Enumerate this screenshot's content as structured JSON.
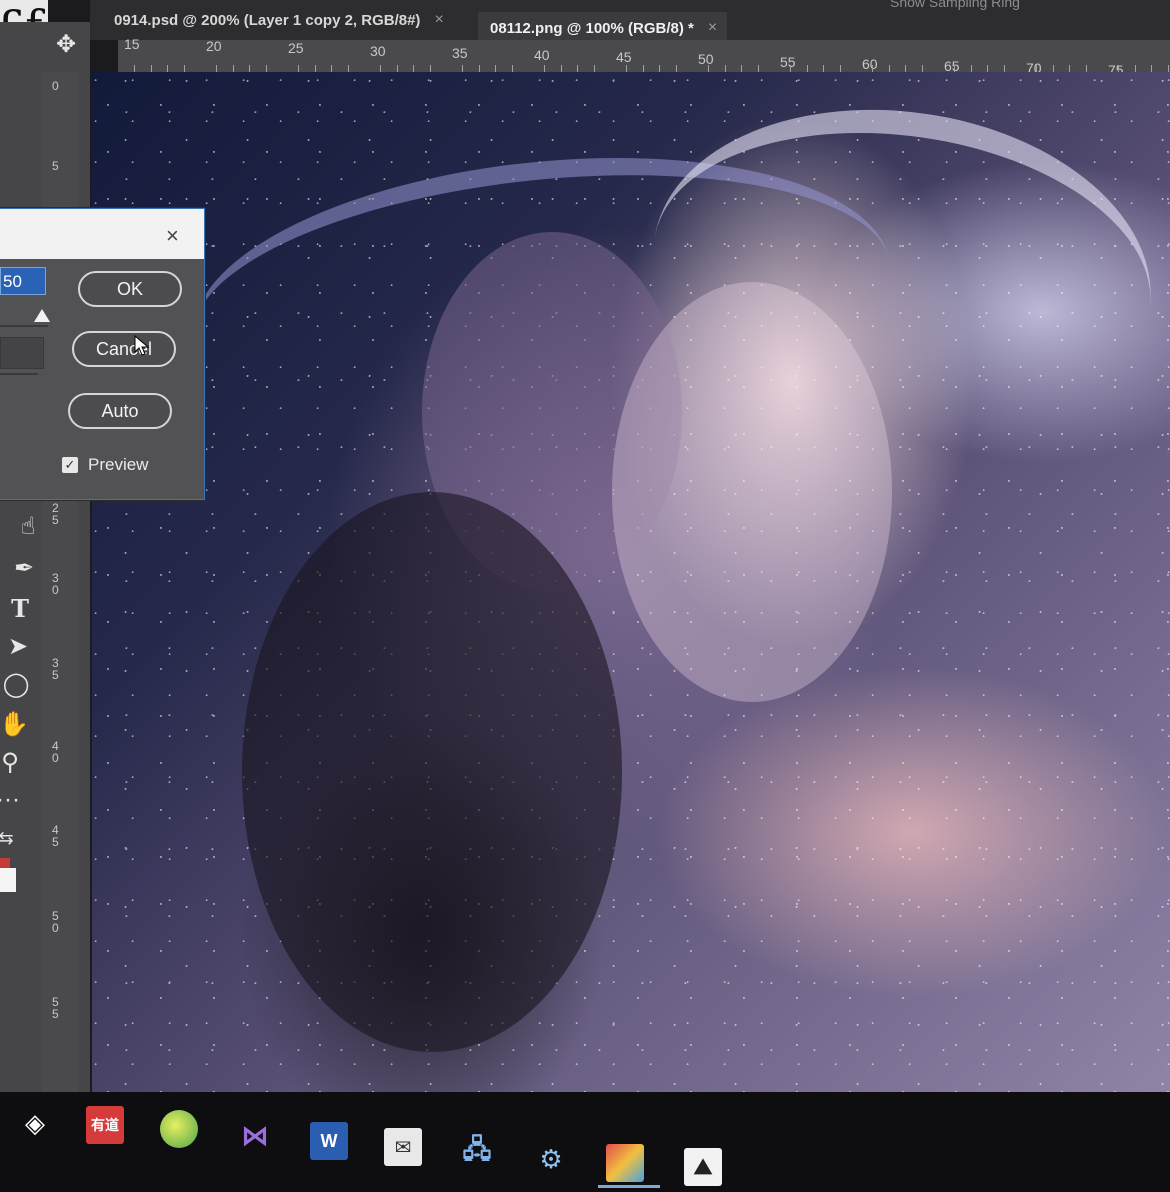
{
  "tabs": [
    {
      "label": "0914.psd @ 200% (Layer 1 copy 2, RGB/8#)",
      "close": "×"
    },
    {
      "label": "08112.png @ 100% (RGB/8) *",
      "close": "×"
    }
  ],
  "options_bar": {
    "sampling_label": "Show Sampling Ring"
  },
  "ruler_h": [
    "15",
    "20",
    "25",
    "30",
    "35",
    "40",
    "45",
    "50",
    "55",
    "60",
    "65",
    "70",
    "75"
  ],
  "ruler_v": [
    "0",
    "5",
    "25",
    "30",
    "35",
    "40",
    "45",
    "50",
    "55"
  ],
  "dialog": {
    "close": "×",
    "value": "50",
    "ok_label": "OK",
    "cancel_label": "Cancel",
    "auto_label": "Auto",
    "preview_label": "Preview",
    "preview_checked": true
  },
  "toolbar_icons": [
    "move-icon",
    "marquee-icon",
    "lasso-icon",
    "magic-wand-icon",
    "crop-icon",
    "brush-icon",
    "smudge-icon",
    "pen-icon",
    "type-icon",
    "path-select-icon",
    "ellipse-icon",
    "hand-icon",
    "zoom-icon",
    "more-icon",
    "swap-colors-icon"
  ],
  "taskbar_icons": [
    "unity-icon",
    "youdao-icon",
    "tennis-app-icon",
    "visual-studio-icon",
    "word-icon",
    "mail-icon",
    "network-icon",
    "control-panel-icon",
    "photo-app-icon",
    "photoshop-image-icon"
  ],
  "colors": {
    "accent": "#3a74b5",
    "panel": "#525254",
    "toolbar": "#464648",
    "taskbar": "#0e0e10"
  }
}
